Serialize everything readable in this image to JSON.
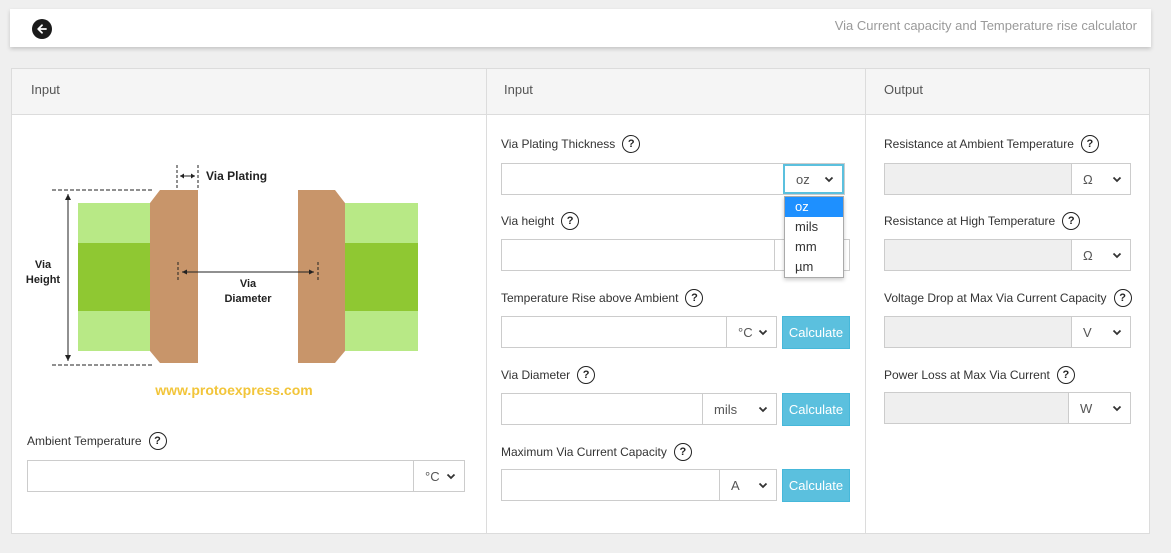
{
  "header": {
    "title": "Via Current capacity and Temperature rise calculator",
    "back_icon": "arrow-left-icon"
  },
  "panels": {
    "input1": {
      "heading": "Input",
      "diagram": {
        "via_plating": "Via Plating",
        "via_height_line1": "Via",
        "via_height_line2": "Height",
        "via_diameter_line1": "Via",
        "via_diameter_line2": "Diameter",
        "website": "www.protoexpress.com"
      },
      "ambient_temperature": {
        "label": "Ambient Temperature",
        "value": "",
        "unit": "°C"
      }
    },
    "input2": {
      "heading": "Input",
      "via_plating_thickness": {
        "label": "Via Plating Thickness",
        "value": "",
        "unit": "oz",
        "options": [
          "oz",
          "mils",
          "mm",
          "µm"
        ]
      },
      "via_height": {
        "label": "Via height",
        "value": "",
        "unit": ""
      },
      "temperature_rise": {
        "label": "Temperature Rise above Ambient",
        "value": "",
        "unit": "°C",
        "button": "Calculate"
      },
      "via_diameter": {
        "label": "Via Diameter",
        "value": "",
        "unit": "mils",
        "button": "Calculate"
      },
      "max_via_current": {
        "label": "Maximum Via Current Capacity",
        "value": "",
        "unit": "A",
        "button": "Calculate"
      }
    },
    "output": {
      "heading": "Output",
      "resistance_ambient": {
        "label": "Resistance at Ambient Temperature",
        "value": "",
        "unit": "Ω"
      },
      "resistance_high": {
        "label": "Resistance at High Temperature",
        "value": "",
        "unit": "Ω"
      },
      "voltage_drop": {
        "label": "Voltage Drop at Max Via Current Capacity",
        "value": "",
        "unit": "V"
      },
      "power_loss": {
        "label": "Power Loss at Max Via Current",
        "value": "",
        "unit": "W"
      }
    }
  },
  "help_symbol": "?",
  "colors": {
    "accent": "#5bc0de",
    "selected_option": "#1e90ff",
    "copper": "#c8956a",
    "board_light": "#b8e986",
    "board_dark": "#8fc832",
    "watermark": "#f2c53a"
  }
}
